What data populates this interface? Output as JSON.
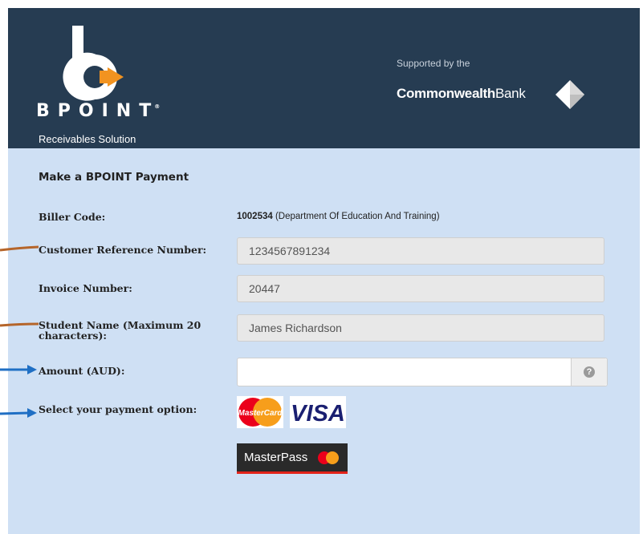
{
  "header": {
    "brand": "BPOINT",
    "brand_mark": "®",
    "sub_brand": "Receivables Solution",
    "supported_by": "Supported by the",
    "bank_bold": "Commonwealth",
    "bank_light": "Bank",
    "logo_icon": "bpoint-b-logo",
    "bank_icon": "cba-diamond-logo"
  },
  "form": {
    "title": "Make a BPOINT Payment",
    "biller_label": "Biller Code:",
    "biller_code": "1002534",
    "biller_name": " (Department Of Education And Training)",
    "crn_label": "Customer Reference Number:",
    "crn_value": "1234567891234",
    "invoice_label": "Invoice Number:",
    "invoice_value": "20447",
    "student_label_line1": "Student Name (Maximum 20",
    "student_label_line2": "characters):",
    "student_value": "James Richardson",
    "amount_label": "Amount (AUD):",
    "amount_value": "",
    "help_glyph": "?",
    "payment_label": "Select your payment option:",
    "mastercard_text": "MasterCard",
    "visa_text": "VISA",
    "masterpass_text": "MasterPass"
  },
  "colors": {
    "header_bg": "#263c52",
    "page_bg": "#cfe0f4",
    "logo_orange": "#f29320",
    "annotation_brown": "#b5652a",
    "annotation_blue": "#1f6fc4"
  }
}
